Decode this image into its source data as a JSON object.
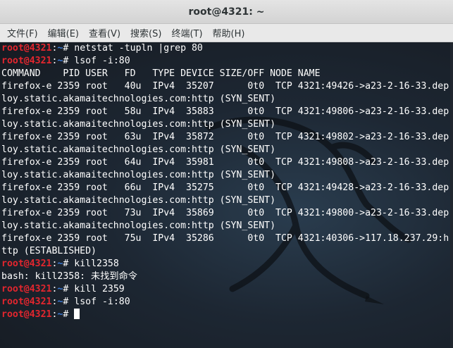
{
  "window": {
    "title": "root@4321: ~"
  },
  "menu": {
    "items": [
      "文件(F)",
      "编辑(E)",
      "查看(V)",
      "搜索(S)",
      "终端(T)",
      "帮助(H)"
    ]
  },
  "terminal": {
    "prompt": {
      "user_host": "root@4321",
      "colon": ":",
      "path": "~",
      "symbol": "# "
    },
    "lines": [
      {
        "type": "prompt",
        "cmd": "netstat -tupln |grep 80"
      },
      {
        "type": "prompt",
        "cmd": "lsof -i:80"
      },
      {
        "type": "output",
        "text": "COMMAND    PID USER   FD   TYPE DEVICE SIZE/OFF NODE NAME"
      },
      {
        "type": "output",
        "text": "firefox-e 2359 root   40u  IPv4  35207      0t0  TCP 4321:49426->a23-2-16-33.dep"
      },
      {
        "type": "output",
        "text": "loy.static.akamaitechnologies.com:http (SYN_SENT)"
      },
      {
        "type": "output",
        "text": "firefox-e 2359 root   58u  IPv4  35883      0t0  TCP 4321:49806->a23-2-16-33.dep"
      },
      {
        "type": "output",
        "text": "loy.static.akamaitechnologies.com:http (SYN_SENT)"
      },
      {
        "type": "output",
        "text": "firefox-e 2359 root   63u  IPv4  35872      0t0  TCP 4321:49802->a23-2-16-33.dep"
      },
      {
        "type": "output",
        "text": "loy.static.akamaitechnologies.com:http (SYN_SENT)"
      },
      {
        "type": "output",
        "text": "firefox-e 2359 root   64u  IPv4  35981      0t0  TCP 4321:49808->a23-2-16-33.dep"
      },
      {
        "type": "output",
        "text": "loy.static.akamaitechnologies.com:http (SYN_SENT)"
      },
      {
        "type": "output",
        "text": "firefox-e 2359 root   66u  IPv4  35275      0t0  TCP 4321:49428->a23-2-16-33.dep"
      },
      {
        "type": "output",
        "text": "loy.static.akamaitechnologies.com:http (SYN_SENT)"
      },
      {
        "type": "output",
        "text": "firefox-e 2359 root   73u  IPv4  35869      0t0  TCP 4321:49800->a23-2-16-33.dep"
      },
      {
        "type": "output",
        "text": "loy.static.akamaitechnologies.com:http (SYN_SENT)"
      },
      {
        "type": "output",
        "text": "firefox-e 2359 root   75u  IPv4  35286      0t0  TCP 4321:40306->117.18.237.29:h"
      },
      {
        "type": "output",
        "text": "ttp (ESTABLISHED)"
      },
      {
        "type": "prompt",
        "cmd": "kill2358"
      },
      {
        "type": "output",
        "text": "bash: kill2358: 未找到命令"
      },
      {
        "type": "prompt",
        "cmd": "kill 2359"
      },
      {
        "type": "prompt",
        "cmd": "lsof -i:80"
      },
      {
        "type": "prompt",
        "cmd": "",
        "cursor": true
      }
    ]
  }
}
